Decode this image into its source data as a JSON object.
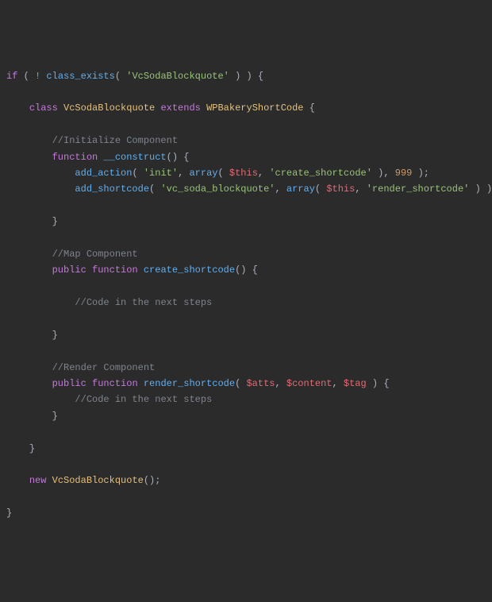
{
  "c": {
    "if": "if",
    "class": "class",
    "extends": "extends",
    "function": "function",
    "public": "public",
    "new": "new",
    "class_exists": "class_exists",
    "VcSodaBlockquote": "VcSodaBlockquote",
    "WPBakeryShortCode": "WPBakeryShortCode",
    "construct": "__construct",
    "add_action": "add_action",
    "add_shortcode": "add_shortcode",
    "array": "array",
    "this": "$this",
    "create_shortcode": "create_shortcode",
    "render_shortcode": "render_shortcode",
    "atts": "$atts",
    "content": "$content",
    "tag": "$tag",
    "str_vc": "'VcSodaBlockquote'",
    "str_init": "'init'",
    "str_create": "'create_shortcode'",
    "str_vcsoda": "'vc_soda_blockquote'",
    "str_render": "'render_shortcode'",
    "num999": "999",
    "cmt_init": "//Initialize Component",
    "cmt_map": "//Map Component",
    "cmt_render": "//Render Component",
    "cmt_steps": "//Code in the next steps"
  }
}
